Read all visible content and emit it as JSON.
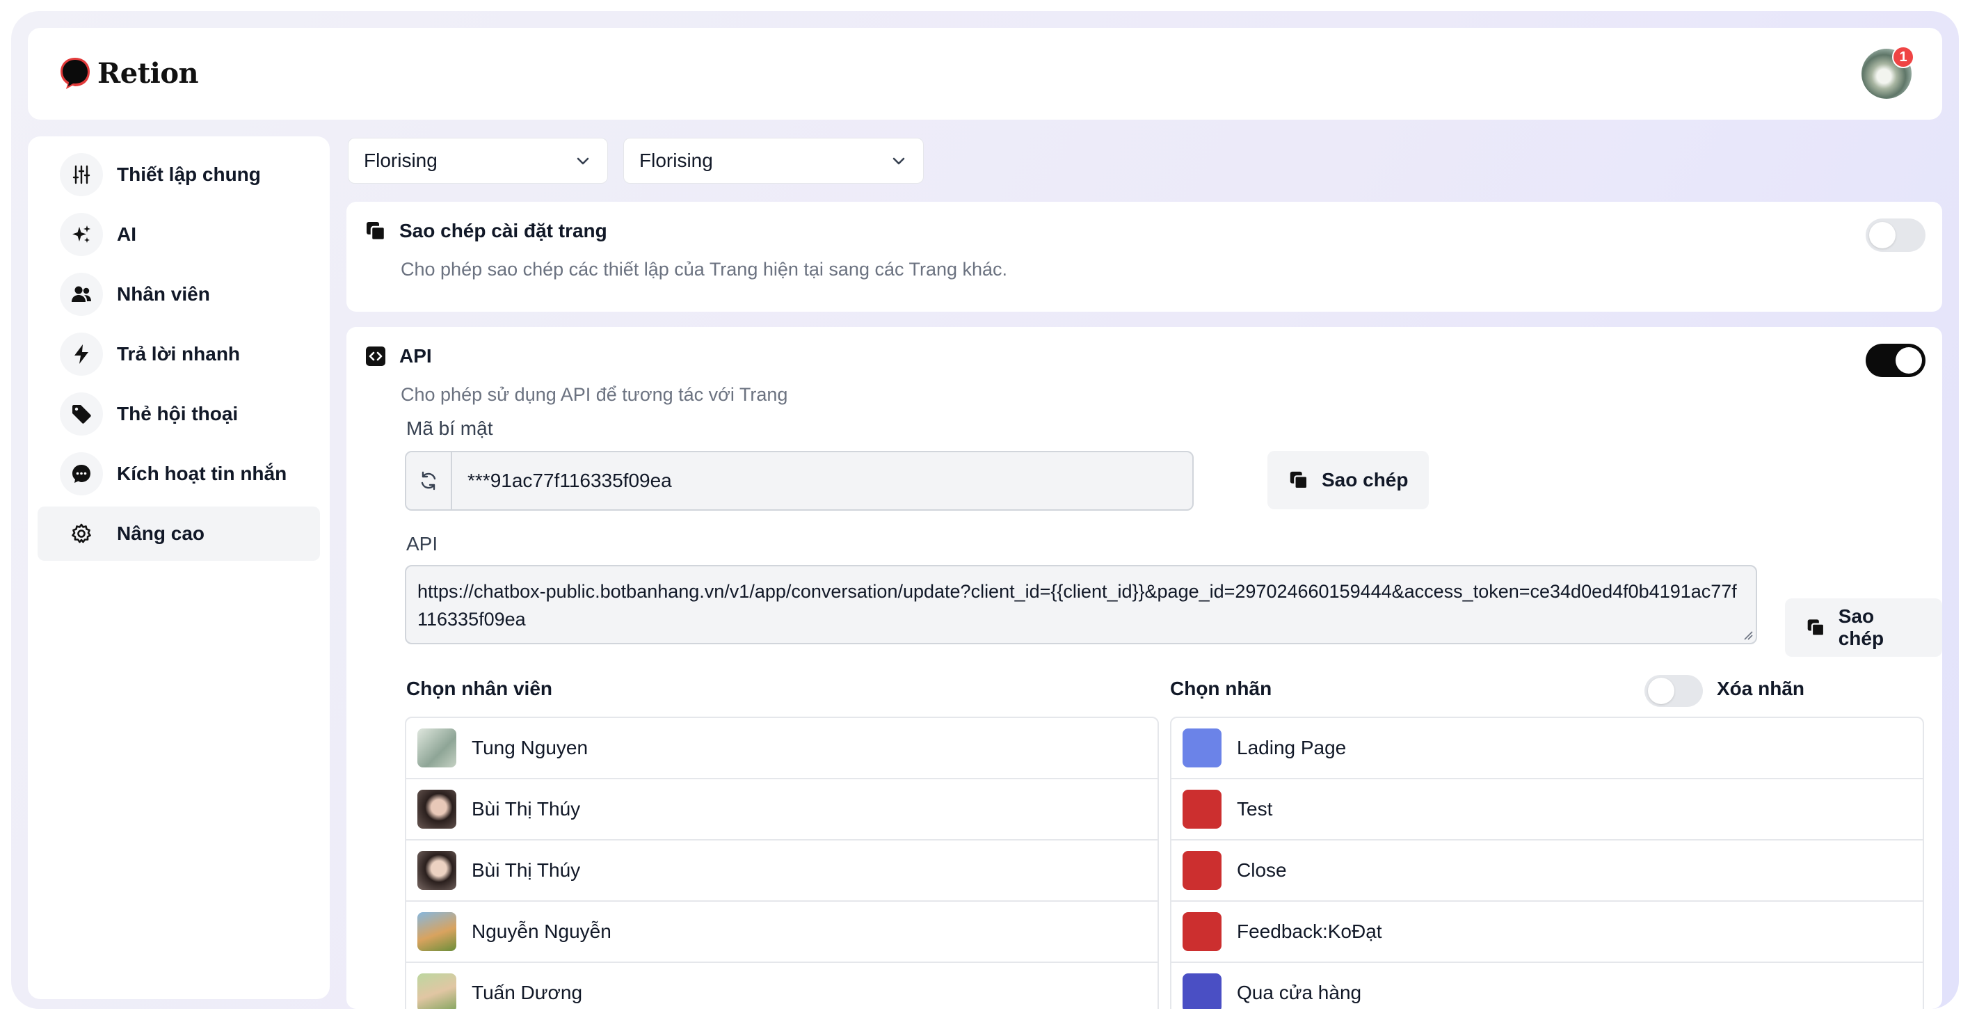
{
  "app": {
    "name": "Retion"
  },
  "notifications": {
    "count": "1"
  },
  "sidebar": {
    "items": [
      {
        "label": "Thiết lập chung",
        "icon": "sliders-icon"
      },
      {
        "label": "AI",
        "icon": "sparkles-icon"
      },
      {
        "label": "Nhân viên",
        "icon": "users-icon"
      },
      {
        "label": "Trả lời nhanh",
        "icon": "bolt-icon"
      },
      {
        "label": "Thẻ hội thoại",
        "icon": "tag-icon"
      },
      {
        "label": "Kích hoạt tin nhắn",
        "icon": "chat-bubble-icon"
      },
      {
        "label": "Nâng cao",
        "icon": "gear-icon",
        "active": true
      }
    ]
  },
  "selectors": {
    "first": {
      "value": "Florising"
    },
    "second": {
      "value": "Florising"
    }
  },
  "copy_settings": {
    "title": "Sao chép cài đặt trang",
    "description": "Cho phép sao chép các thiết lập của Trang hiện tại sang các Trang khác.",
    "enabled": false
  },
  "api": {
    "title": "API",
    "description": "Cho phép sử dụng API để tương tác với Trang",
    "enabled": true,
    "secret_label": "Mã bí mật",
    "secret_value": "***91ac77f116335f09ea",
    "copy_label": "Sao chép",
    "url_label": "API",
    "url_value": "https://chatbox-public.botbanhang.vn/v1/app/conversation/update?client_id={{client_id}}&page_id=297024660159444&access_token=ce34d0ed4f0b4191ac77f116335f09ea",
    "copy_url_label": "Sao chép"
  },
  "staff": {
    "label": "Chọn nhân viên",
    "items": [
      {
        "name": "Tung Nguyen",
        "thumb": "linear-gradient(135deg,#dfe7de,#8ea596 60%,#c6d2c4)"
      },
      {
        "name": "Bùi Thị Thúy",
        "thumb": "radial-gradient(circle at 55% 45%,#e8c8b8 0 25%,#2a1f1d 45%,#6b5a55 100%)"
      },
      {
        "name": "Bùi Thị Thúy",
        "thumb": "radial-gradient(circle at 55% 45%,#ecd2c2 0 25%,#2a1f1d 45%,#7a6a65 100%)"
      },
      {
        "name": "Nguyễn Nguyễn",
        "thumb": "linear-gradient(160deg,#86b7de,#d9a35f 55%,#6b8e3a)"
      },
      {
        "name": "Tuấn Dương",
        "thumb": "linear-gradient(160deg,#bcd7a0,#e1c6a3 50%,#7da35a)"
      }
    ]
  },
  "labels": {
    "label": "Chọn nhãn",
    "delete_label": "Xóa nhãn",
    "delete_enabled": false,
    "items": [
      {
        "name": "Lading Page",
        "color": "#6b83e8"
      },
      {
        "name": "Test",
        "color": "#cc2f2f"
      },
      {
        "name": "Close",
        "color": "#cc2f2f"
      },
      {
        "name": "Feedback:KoĐạt",
        "color": "#cc2f2f"
      },
      {
        "name": "Qua cửa hàng",
        "color": "#4a4fc4"
      }
    ]
  }
}
